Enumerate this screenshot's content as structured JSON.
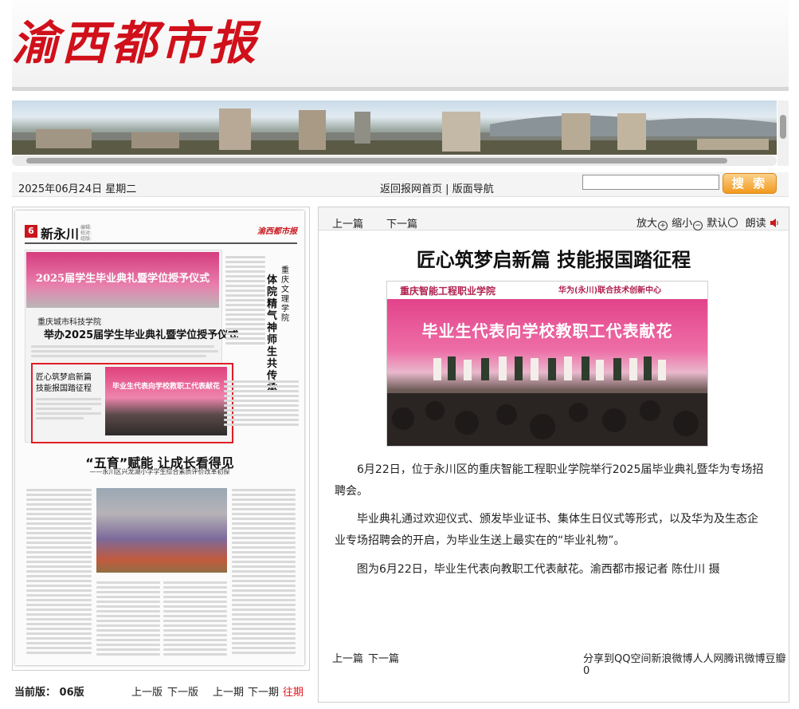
{
  "masthead": {
    "logo_text": "渝西都市报"
  },
  "datebar": {
    "date": "2025年06月24日 星期二",
    "home_link": "返回报网首页",
    "separator": "|",
    "nav_link": "版面导航",
    "search_placeholder": "",
    "search_button": "搜 索"
  },
  "page_preview": {
    "page_number": "6",
    "section_name": "新永川",
    "meta_lines": [
      "编辑:",
      "校对:",
      "组版:"
    ],
    "mini_logo": "渝西都市报",
    "top_story": {
      "banner_text": "2025届学生毕业典礼暨学位授予仪式",
      "org": "重庆城市科技学院",
      "headline": "举办2025届学生毕业典礼暨学位授予仪式"
    },
    "highlighted_story": {
      "title_line1": "匠心筑梦启新篇",
      "title_line2": "技能报国踏征程",
      "banner_text": "毕业生代表向学校教职工代表献花"
    },
    "side_story": {
      "school": "重庆文理学院",
      "title": "体院精气神 师生共传承"
    },
    "feature": {
      "title": "“五育”赋能 让成长看得见",
      "subtitle": "——永川区兴龙湖小学学生综合素质评价改革初探"
    }
  },
  "article": {
    "prev": "上一篇",
    "next": "下一篇",
    "zoom_in": "放大",
    "zoom_out": "缩小",
    "default": "默认",
    "read_aloud": "朗读",
    "title": "匠心筑梦启新篇 技能报国踏征程",
    "photo": {
      "school_name": "重庆智能工程职业学院",
      "center_name": "华为(永川)联合技术创新中心",
      "banner_text": "毕业生代表向学校教职工代表献花"
    },
    "paragraphs": [
      "6月22日，位于永川区的重庆智能工程职业学院举行2025届毕业典礼暨华为专场招聘会。",
      "毕业典礼通过欢迎仪式、颁发毕业证书、集体生日仪式等形式，以及华为及生态企业专场招聘会的开启，为毕业生送上最实在的“毕业礼物”。",
      "图为6月22日，毕业生代表向教职工代表献花。渝西都市报记者 陈仕川 摄"
    ],
    "share_text": "分享到QQ空间新浪微博人人网腾讯微博豆瓣0"
  },
  "edition_nav": {
    "current_label": "当前版： 06版",
    "prev_edition": "上一版",
    "next_edition": "下一版",
    "prev_issue": "上一期",
    "next_issue": "下一期",
    "past_issues": "往期"
  },
  "colors": {
    "brand_red": "#d0101a",
    "search_orange": "#f29a1e"
  }
}
